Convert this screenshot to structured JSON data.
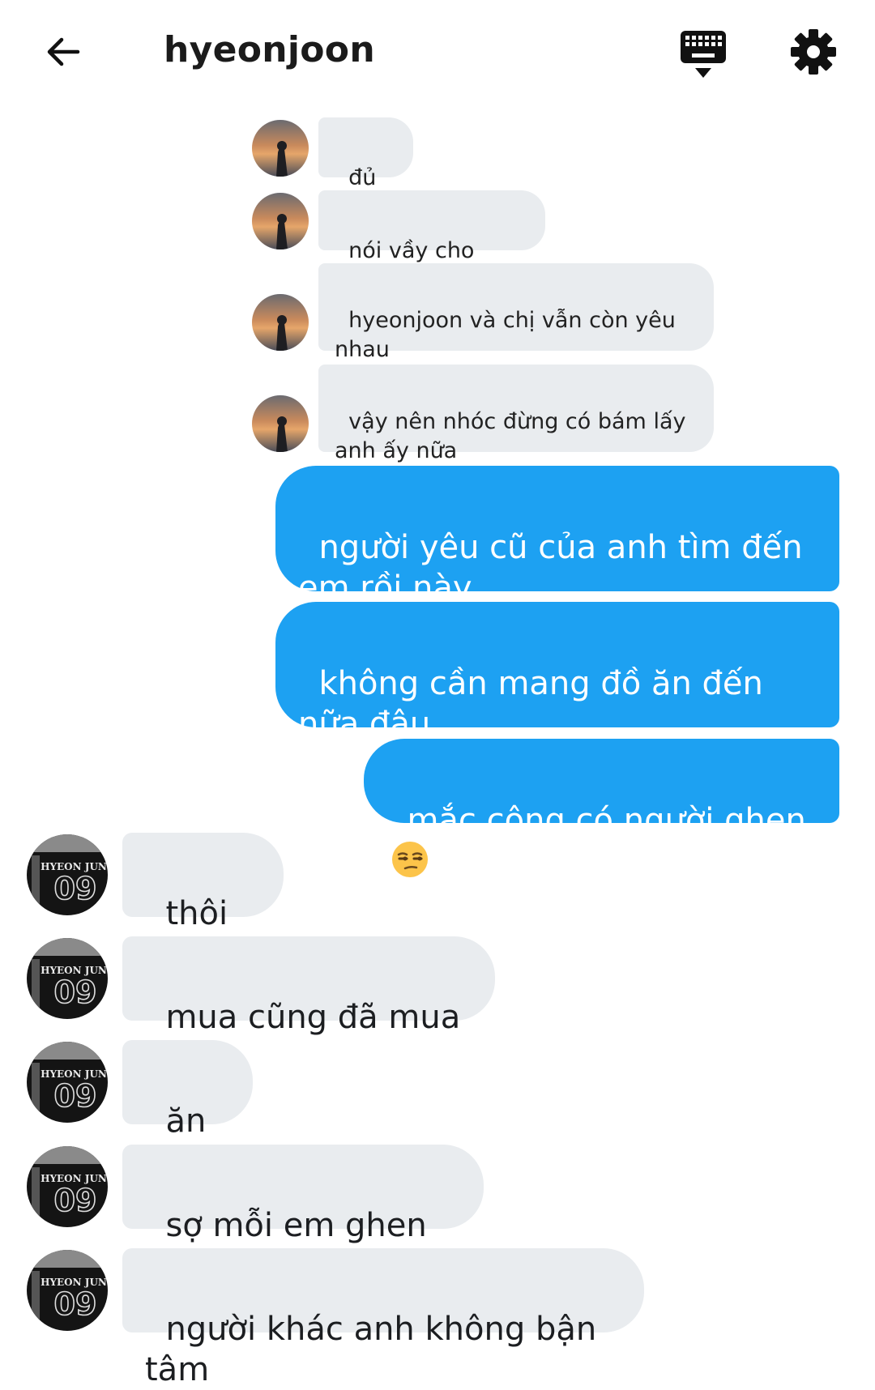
{
  "header": {
    "title": "hyeonjoon",
    "back_icon": "arrow-left-icon",
    "keyboard_icon": "keyboard-icon",
    "settings_icon": "gear-icon"
  },
  "quoted_messages": [
    {
      "text": "đủ rồi"
    },
    {
      "text": "nói vầy cho nhanh"
    },
    {
      "text": "hyeonjoon và chị vẫn còn yêu nhau"
    },
    {
      "text": "vậy nên nhóc đừng có bám lấy anh ấy nữa"
    }
  ],
  "outgoing_messages": [
    {
      "text": "người yêu cũ của anh tìm đến em rồi này"
    },
    {
      "text": "không cần mang đồ ăn đến nữa đâu"
    },
    {
      "text": "mắc công có người ghen",
      "emoji": "unamused-face-emoji"
    }
  ],
  "incoming_messages": [
    {
      "text": "thôi mà"
    },
    {
      "text": "mua cũng đã mua rồi"
    },
    {
      "text": "ăn đi"
    },
    {
      "text": "sợ mỗi em ghen thôi"
    },
    {
      "text": "người khác anh không bận tâm"
    }
  ],
  "colors": {
    "outgoing_bubble": "#1da1f2",
    "incoming_bubble": "#e9ecef",
    "background": "#ffffff"
  }
}
